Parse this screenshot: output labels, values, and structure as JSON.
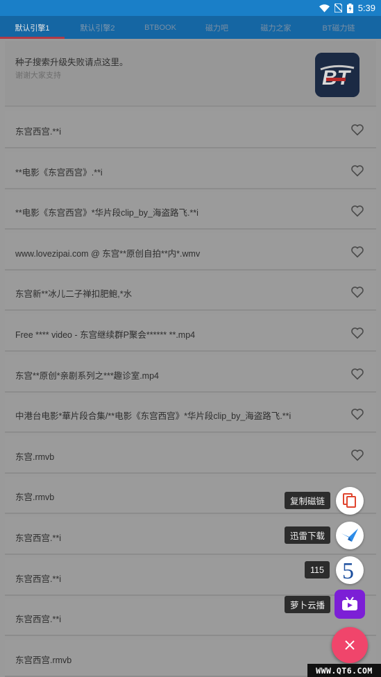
{
  "status_bar": {
    "time": "5:39"
  },
  "tabs": [
    {
      "label": "默认引擎1",
      "active": true
    },
    {
      "label": "默认引擎2",
      "active": false
    },
    {
      "label": "BTBOOK",
      "active": false
    },
    {
      "label": "磁力吧",
      "active": false
    },
    {
      "label": "磁力之家",
      "active": false
    },
    {
      "label": "BT磁力链",
      "active": false
    }
  ],
  "banner": {
    "title": "种子搜索升级失败请点这里。",
    "subtitle": "谢谢大家支持"
  },
  "results": [
    "东宫西宫.**i",
    "**电影《东宫西宫》.**i",
    "**电影《东宫西宫》*华片段clip_by_海盗路飞.**i",
    "www.lovezipai.com @ 东宫**原创自拍**内*.wmv",
    "东宫新**冰儿二子禅扣肥鲍,*水",
    "Free **** video - 东宫继续群P聚会****** **.mp4",
    "东宫**原创*亲剧系列之***趣诊室.mp4",
    "中港台电影*華片段合集/**电影《东宫西宫》*华片段clip_by_海盗路飞.**i",
    "东宫.rmvb",
    "东宫.rmvb",
    "东宫西宫.**i",
    "东宫西宫.**i",
    "东宫西宫.**i",
    "东宫西宫.rmvb"
  ],
  "fab_menu": {
    "copy_label": "复制磁链",
    "xunlei_label": "迅雷下载",
    "label_115": "115",
    "radish_label": "萝卜云播"
  },
  "watermark": "WWW.QT6.COM",
  "colors": {
    "status_bar": "#1a7fc8",
    "tab_bar": "#1566a3",
    "tab_indicator": "#b03a46",
    "fab_main": "#f0456b",
    "radish_icon": "#7c1fd6"
  }
}
